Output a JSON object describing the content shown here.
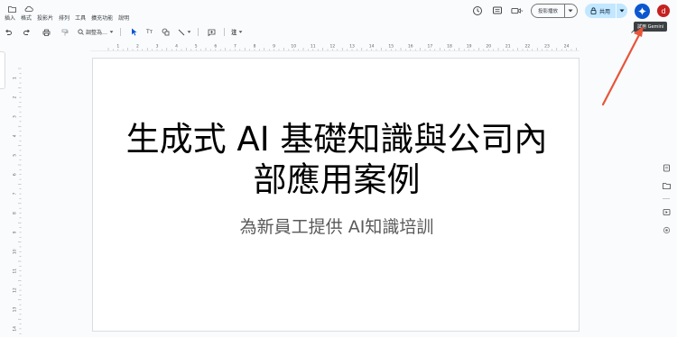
{
  "menu": [
    "插入",
    "格式",
    "投影片",
    "排列",
    "工具",
    "擴充功能",
    "說明"
  ],
  "toolbar": {
    "zoom_label": "調整為…",
    "textbox_label": "Tт",
    "comment_label": "注"
  },
  "actions": {
    "present_label": "投影播放",
    "share_label": "共用",
    "avatar_initial": "d",
    "gemini_tooltip": "試用 Gemini"
  },
  "ruler": {
    "horizontal": [
      "1",
      "2",
      "3",
      "4",
      "5",
      "6",
      "7",
      "8",
      "9",
      "10",
      "11",
      "12",
      "13",
      "14",
      "15",
      "16",
      "17",
      "18",
      "19",
      "20",
      "21",
      "22",
      "23",
      "24",
      "25"
    ],
    "vertical": [
      "1",
      "2",
      "3",
      "4",
      "5",
      "6",
      "7",
      "8",
      "9",
      "10",
      "11",
      "12",
      "13",
      "14"
    ]
  },
  "slide": {
    "title_line1": "生成式 AI 基礎知識與公司內",
    "title_line2": "部應用案例",
    "subtitle": "為新員工提供 AI知識培訓"
  },
  "colors": {
    "share_bg": "#c2e7ff",
    "gemini_bg": "#0b57d0",
    "avatar_bg": "#c5221f",
    "arrow": "#e8553a"
  }
}
